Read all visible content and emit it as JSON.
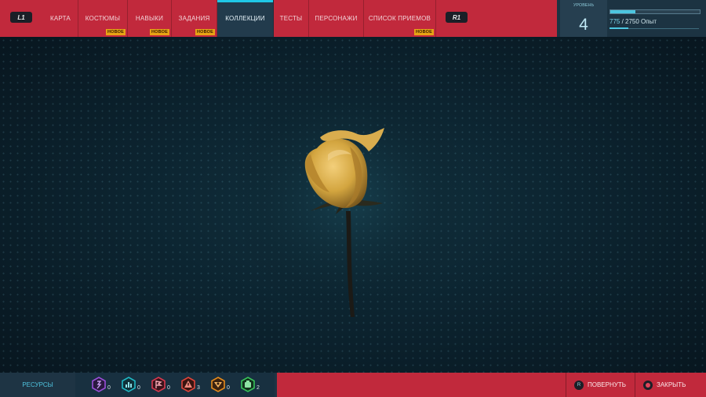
{
  "nav": {
    "l1": "L1",
    "r1": "R1",
    "tabs": [
      {
        "label": "КАРТА",
        "badge": ""
      },
      {
        "label": "КОСТЮМЫ",
        "badge": "НОВОЕ"
      },
      {
        "label": "НАВЫКИ",
        "badge": "НОВОЕ"
      },
      {
        "label": "ЗАДАНИЯ",
        "badge": "НОВОЕ"
      },
      {
        "label": "КОЛЛЕКЦИИ",
        "badge": ""
      },
      {
        "label": "ТЕСТЫ",
        "badge": ""
      },
      {
        "label": "ПЕРСОНАЖИ",
        "badge": ""
      },
      {
        "label": "СПИСОК ПРИЕМОВ",
        "badge": "НОВОЕ"
      }
    ],
    "active_tab": "КОЛЛЕКЦИИ"
  },
  "level": {
    "label": "УРОВЕНЬ",
    "value": "4",
    "xp_current": "775",
    "xp_rest": " / 2750 Опыт",
    "xp_progress": 0.28
  },
  "resources": {
    "label": "РЕСУРСЫ",
    "items": [
      {
        "icon": "purple-hex-token-icon",
        "count": "0",
        "color": "#9b4fd8"
      },
      {
        "icon": "teal-hex-token-icon",
        "count": "0",
        "color": "#20b8c4"
      },
      {
        "icon": "red-flag-hex-token-icon",
        "count": "0",
        "color": "#d8394e"
      },
      {
        "icon": "red-warning-hex-token-icon",
        "count": "3",
        "color": "#e0443a"
      },
      {
        "icon": "orange-hex-token-icon",
        "count": "0",
        "color": "#e58a1c"
      },
      {
        "icon": "green-hex-token-icon",
        "count": "2",
        "color": "#38c25a"
      }
    ]
  },
  "actions": {
    "rotate_key": "R",
    "rotate": "ПОВЕРНУТЬ",
    "close": "ЗАКРЫТЬ"
  },
  "colors": {
    "accent": "#c1293c",
    "highlight": "#1fc7e6"
  }
}
